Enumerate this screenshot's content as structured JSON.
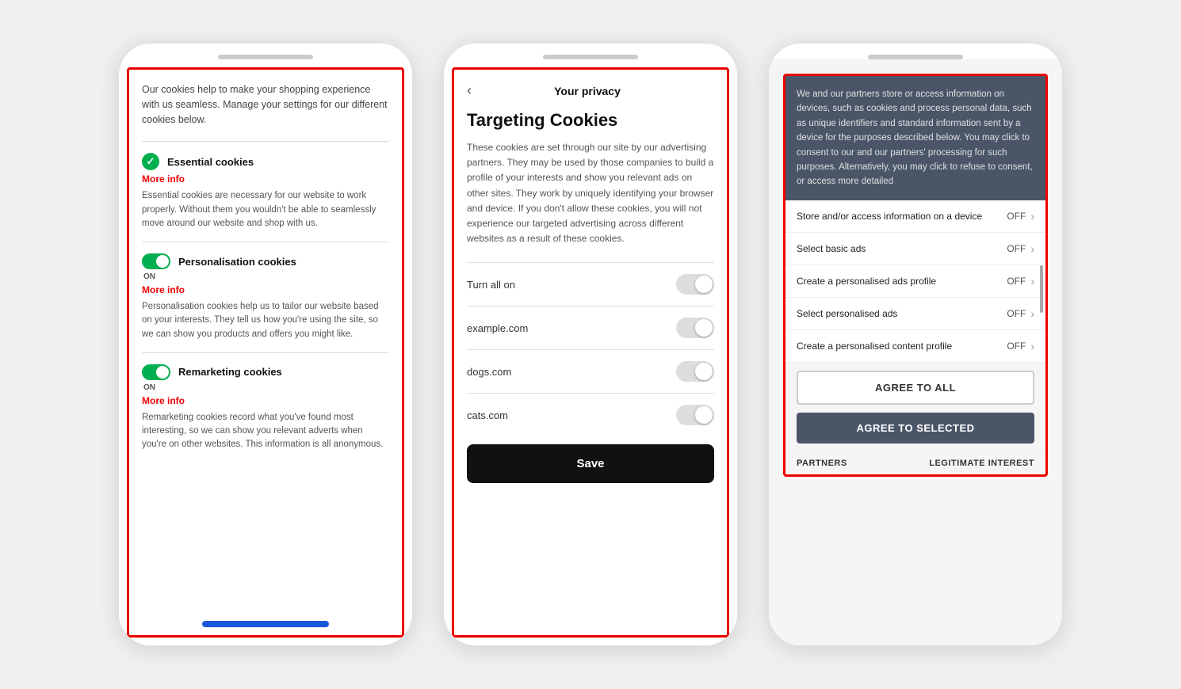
{
  "phone1": {
    "intro": "Our cookies help to make your shopping experience with us seamless. Manage your settings for our different cookies below.",
    "sections": [
      {
        "type": "check",
        "title": "Essential cookies",
        "more_info": "More info",
        "desc": "Essential cookies are necessary for our website to work properly. Without them you wouldn't be able to seamlessly move around our website and shop with us."
      },
      {
        "type": "toggle-on",
        "title": "Personalisation cookies",
        "on_label": "ON",
        "more_info": "More info",
        "desc": "Personalisation cookies help us to tailor our website based on your interests. They tell us how you're using the site, so we can show you products and offers you might like."
      },
      {
        "type": "toggle-on",
        "title": "Remarketing cookies",
        "on_label": "ON",
        "more_info": "More info",
        "desc": "Remarketing cookies record what you've found most interesting, so we can show you relevant adverts when you're on other websites. This information is all anonymous."
      }
    ]
  },
  "phone2": {
    "back_label": "‹",
    "header_title": "Your privacy",
    "section_title": "Targeting Cookies",
    "section_desc": "These cookies are set through our site by our advertising partners. They may be used by those companies to build a profile of your interests and show you relevant ads on other sites. They work by uniquely identifying your browser and device. If you don't allow these cookies, you will not experience our targeted advertising across different websites as a result of these cookies.",
    "toggle_rows": [
      {
        "label": "Turn all on"
      },
      {
        "label": "example.com"
      },
      {
        "label": "dogs.com"
      },
      {
        "label": "cats.com"
      }
    ],
    "save_button": "Save"
  },
  "phone3": {
    "desc": "We and our partners store or access information on devices, such as cookies and process personal data, such as unique identifiers and standard information sent by a device for the purposes described below. You may click to consent to our and our partners' processing for such purposes. Alternatively, you may click to refuse to consent, or access more detailed",
    "consent_rows": [
      {
        "label": "Store and/or access information on a device",
        "value": "OFF"
      },
      {
        "label": "Select basic ads",
        "value": "OFF"
      },
      {
        "label": "Create a personalised ads profile",
        "value": "OFF"
      },
      {
        "label": "Select personalised ads",
        "value": "OFF"
      },
      {
        "label": "Create a personalised content profile",
        "value": "OFF"
      }
    ],
    "agree_all_btn": "AGREE TO ALL",
    "agree_selected_btn": "AGREE TO SELECTED",
    "partners_label": "PARTNERS",
    "legit_interest_label": "LEGITIMATE INTEREST"
  }
}
